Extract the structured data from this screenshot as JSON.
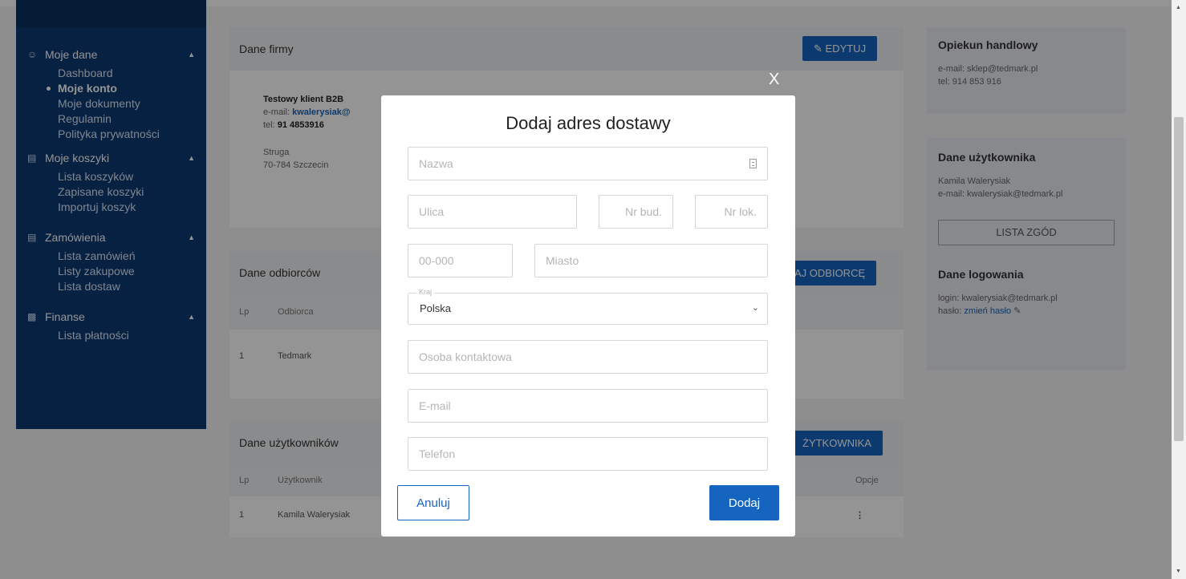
{
  "sidebar": {
    "groups": [
      {
        "icon": "user-icon",
        "label": "Moje dane",
        "items": [
          "Dashboard",
          "Moje konto",
          "Moje dokumenty",
          "Regulamin",
          "Polityka prywatności"
        ]
      },
      {
        "icon": "cart-icon",
        "label": "Moje koszyki",
        "items": [
          "Lista koszyków",
          "Zapisane koszyki",
          "Importuj koszyk"
        ]
      },
      {
        "icon": "cart-icon",
        "label": "Zamówienia",
        "items": [
          "Lista zamówień",
          "Listy zakupowe",
          "Lista dostaw"
        ]
      },
      {
        "icon": "wallet-icon",
        "label": "Finanse",
        "items": [
          "Lista płatności"
        ]
      }
    ],
    "active_item": "Moje konto"
  },
  "company": {
    "header": "Dane firmy",
    "edit_label": "EDYTUJ",
    "name": "Testowy klient B2B",
    "email_label": "e-mail:",
    "email": "kwalerysiak@",
    "phone_label": "tel:",
    "phone": "91 4853916",
    "street": "Struga",
    "city": "70-784 Szczecin"
  },
  "recipients": {
    "header": "Dane odbiorców",
    "add_label": "AJ ODBIORCĘ",
    "columns": [
      "Lp",
      "Odbiorca"
    ],
    "rows": [
      [
        "1",
        "Tedmark"
      ]
    ]
  },
  "users": {
    "header": "Dane użytkowników",
    "add_label": "ŻYTKOWNIKA",
    "columns": [
      "Lp",
      "Użytkownik",
      "Opcje"
    ],
    "rows": [
      [
        "1",
        "Kamila Walerysiak"
      ]
    ]
  },
  "right": {
    "advisor": {
      "title": "Opiekun handlowy",
      "email": "e-mail: sklep@tedmark.pl",
      "phone": "tel: 914 853 916"
    },
    "user": {
      "title": "Dane użytkownika",
      "name": "Kamila Walerysiak",
      "email": "e-mail: kwalerysiak@tedmark.pl",
      "consents_label": "LISTA ZGÓD"
    },
    "login": {
      "title": "Dane logowania",
      "login": "login: kwalerysiak@tedmark.pl",
      "password_label": "hasło:",
      "password_link": "zmień hasło"
    }
  },
  "modal": {
    "close": "X",
    "title": "Dodaj adres dostawy",
    "fields": {
      "name": "Nazwa",
      "street": "Ulica",
      "building": "Nr bud.",
      "apartment": "Nr lok.",
      "postcode": "00-000",
      "city": "Miasto",
      "country_label": "Kraj",
      "country_value": "Polska",
      "contact": "Osoba kontaktowa",
      "email": "E-mail",
      "phone": "Telefon"
    },
    "cancel_label": "Anuluj",
    "add_label": "Dodaj"
  }
}
